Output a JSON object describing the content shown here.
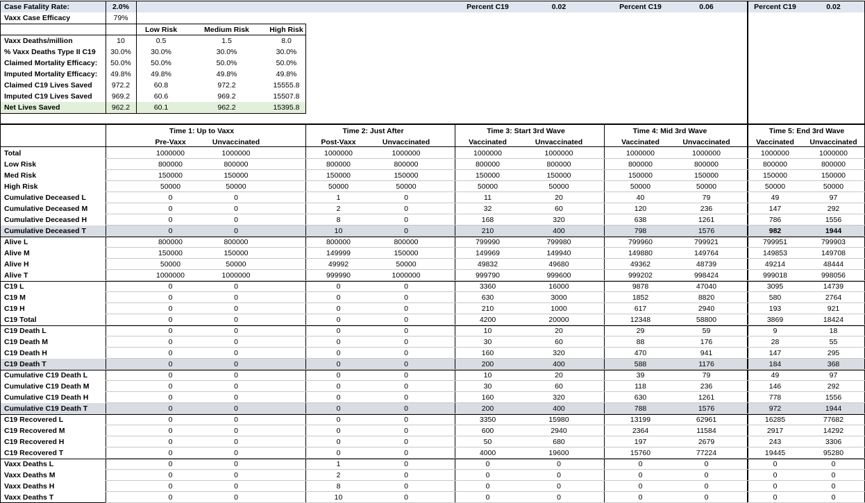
{
  "summary": {
    "case_fatality_label": "Case Fatality Rate:",
    "case_fatality_value": "2.0%",
    "vaxx_efficacy_label": "Vaxx Case Efficacy",
    "vaxx_efficacy_value": "79%",
    "percent_blocks": [
      {
        "label": "Percent C19",
        "value": "0.02"
      },
      {
        "label": "Percent C19",
        "value": "0.06"
      },
      {
        "label": "Percent C19",
        "value": "0.02"
      }
    ]
  },
  "risk_table": {
    "headers": [
      "Low Risk",
      "Medium Risk",
      "High Risk"
    ],
    "rows": [
      {
        "label": "Vaxx Deaths/million",
        "base": "10",
        "cells": [
          "0.5",
          "1.5",
          "8.0"
        ]
      },
      {
        "label": "% Vaxx Deaths Type II C19",
        "base": "30.0%",
        "cells": [
          "30.0%",
          "30.0%",
          "30.0%"
        ]
      },
      {
        "label": "Claimed Mortality Efficacy:",
        "base": "50.0%",
        "cells": [
          "50.0%",
          "50.0%",
          "50.0%"
        ]
      },
      {
        "label": "Imputed Mortality Efficacy:",
        "base": "49.8%",
        "cells": [
          "49.8%",
          "49.8%",
          "49.8%"
        ]
      },
      {
        "label": "Claimed C19 Lives Saved",
        "base": "972.2",
        "cells": [
          "60.8",
          "972.2",
          "15555.8"
        ]
      },
      {
        "label": "Imputed C19 Lives Saved",
        "base": "969.2",
        "cells": [
          "60.6",
          "969.2",
          "15507.8"
        ]
      },
      {
        "label": "Net Lives Saved",
        "base": "962.2",
        "cells": [
          "60.1",
          "962.2",
          "15395.8"
        ]
      }
    ]
  },
  "time_groups": [
    {
      "title": "Time 1: Up to Vaxx",
      "cols": [
        "Pre-Vaxx",
        "Unvaccinated"
      ]
    },
    {
      "title": "Time 2: Just After",
      "cols": [
        "Post-Vaxx",
        "Unvaccinated"
      ]
    },
    {
      "title": "Time 3: Start 3rd Wave",
      "cols": [
        "Vaccinated",
        "Unvaccinated"
      ]
    },
    {
      "title": "Time 4: Mid 3rd Wave",
      "cols": [
        "Vaccinated",
        "Unvaccinated"
      ]
    },
    {
      "title": "Time 5: End 3rd Wave",
      "cols": [
        "Vaccinated",
        "Unvaccinated"
      ]
    }
  ],
  "rows": [
    {
      "label": "Total",
      "values": [
        "1000000",
        "1000000",
        "1000000",
        "1000000",
        "1000000",
        "1000000",
        "1000000",
        "1000000",
        "1000000",
        "1000000"
      ]
    },
    {
      "label": "Low Risk",
      "values": [
        "800000",
        "800000",
        "800000",
        "800000",
        "800000",
        "800000",
        "800000",
        "800000",
        "800000",
        "800000"
      ]
    },
    {
      "label": "Med Risk",
      "values": [
        "150000",
        "150000",
        "150000",
        "150000",
        "150000",
        "150000",
        "150000",
        "150000",
        "150000",
        "150000"
      ]
    },
    {
      "label": "High Risk",
      "values": [
        "50000",
        "50000",
        "50000",
        "50000",
        "50000",
        "50000",
        "50000",
        "50000",
        "50000",
        "50000"
      ]
    },
    {
      "label": "Cumulative Deceased L",
      "values": [
        "0",
        "0",
        "1",
        "0",
        "11",
        "20",
        "40",
        "79",
        "49",
        "97"
      ]
    },
    {
      "label": "Cumulative Deceased M",
      "values": [
        "0",
        "0",
        "2",
        "0",
        "32",
        "60",
        "120",
        "236",
        "147",
        "292"
      ]
    },
    {
      "label": "Cumulative Deceased H",
      "values": [
        "0",
        "0",
        "8",
        "0",
        "168",
        "320",
        "638",
        "1261",
        "786",
        "1556"
      ]
    },
    {
      "label": "Cumulative Deceased T",
      "values": [
        "0",
        "0",
        "10",
        "0",
        "210",
        "400",
        "798",
        "1576",
        "982",
        "1944"
      ],
      "highlight": true,
      "bold_last": true
    },
    {
      "label": "Alive L",
      "values": [
        "800000",
        "800000",
        "800000",
        "800000",
        "799990",
        "799980",
        "799960",
        "799921",
        "799951",
        "799903"
      ]
    },
    {
      "label": "Alive M",
      "values": [
        "150000",
        "150000",
        "149999",
        "150000",
        "149969",
        "149940",
        "149880",
        "149764",
        "149853",
        "149708"
      ]
    },
    {
      "label": "Alive H",
      "values": [
        "50000",
        "50000",
        "49992",
        "50000",
        "49832",
        "49680",
        "49362",
        "48739",
        "49214",
        "48444"
      ]
    },
    {
      "label": "Alive T",
      "values": [
        "1000000",
        "1000000",
        "999990",
        "1000000",
        "999790",
        "999600",
        "999202",
        "998424",
        "999018",
        "998056"
      ]
    },
    {
      "label": "C19 L",
      "values": [
        "0",
        "0",
        "0",
        "0",
        "3360",
        "16000",
        "9878",
        "47040",
        "3095",
        "14739"
      ]
    },
    {
      "label": "C19 M",
      "values": [
        "0",
        "0",
        "0",
        "0",
        "630",
        "3000",
        "1852",
        "8820",
        "580",
        "2764"
      ]
    },
    {
      "label": "C19 H",
      "values": [
        "0",
        "0",
        "0",
        "0",
        "210",
        "1000",
        "617",
        "2940",
        "193",
        "921"
      ]
    },
    {
      "label": "C19 Total",
      "values": [
        "0",
        "0",
        "0",
        "0",
        "4200",
        "20000",
        "12348",
        "58800",
        "3869",
        "18424"
      ]
    },
    {
      "label": "C19 Death L",
      "values": [
        "0",
        "0",
        "0",
        "0",
        "10",
        "20",
        "29",
        "59",
        "9",
        "18"
      ]
    },
    {
      "label": "C19 Death M",
      "values": [
        "0",
        "0",
        "0",
        "0",
        "30",
        "60",
        "88",
        "176",
        "28",
        "55"
      ]
    },
    {
      "label": "C19 Death H",
      "values": [
        "0",
        "0",
        "0",
        "0",
        "160",
        "320",
        "470",
        "941",
        "147",
        "295"
      ]
    },
    {
      "label": "C19 Death T",
      "values": [
        "0",
        "0",
        "0",
        "0",
        "200",
        "400",
        "588",
        "1176",
        "184",
        "368"
      ],
      "highlight": true
    },
    {
      "label": "Cumulative C19 Death L",
      "values": [
        "0",
        "0",
        "0",
        "0",
        "10",
        "20",
        "39",
        "79",
        "49",
        "97"
      ]
    },
    {
      "label": "Cumulative C19 Death M",
      "values": [
        "0",
        "0",
        "0",
        "0",
        "30",
        "60",
        "118",
        "236",
        "146",
        "292"
      ]
    },
    {
      "label": "Cumulative C19 Death H",
      "values": [
        "0",
        "0",
        "0",
        "0",
        "160",
        "320",
        "630",
        "1261",
        "778",
        "1556"
      ]
    },
    {
      "label": "Cumulative C19 Death T",
      "values": [
        "0",
        "0",
        "0",
        "0",
        "200",
        "400",
        "788",
        "1576",
        "972",
        "1944"
      ],
      "highlight": true
    },
    {
      "label": "C19 Recovered L",
      "values": [
        "0",
        "0",
        "0",
        "0",
        "3350",
        "15980",
        "13199",
        "62961",
        "16285",
        "77682"
      ]
    },
    {
      "label": "C19 Recovered M",
      "values": [
        "0",
        "0",
        "0",
        "0",
        "600",
        "2940",
        "2364",
        "11584",
        "2917",
        "14292"
      ]
    },
    {
      "label": "C19 Recovered H",
      "values": [
        "0",
        "0",
        "0",
        "0",
        "50",
        "680",
        "197",
        "2679",
        "243",
        "3306"
      ]
    },
    {
      "label": "C19 Recovered T",
      "values": [
        "0",
        "0",
        "0",
        "0",
        "4000",
        "19600",
        "15760",
        "77224",
        "19445",
        "95280"
      ]
    },
    {
      "label": "Vaxx Deaths L",
      "values": [
        "0",
        "0",
        "1",
        "0",
        "0",
        "0",
        "0",
        "0",
        "0",
        "0"
      ]
    },
    {
      "label": "Vaxx Deaths M",
      "values": [
        "0",
        "0",
        "2",
        "0",
        "0",
        "0",
        "0",
        "0",
        "0",
        "0"
      ]
    },
    {
      "label": "Vaxx Deaths H",
      "values": [
        "0",
        "0",
        "8",
        "0",
        "0",
        "0",
        "0",
        "0",
        "0",
        "0"
      ]
    },
    {
      "label": "Vaxx Deaths T",
      "values": [
        "0",
        "0",
        "10",
        "0",
        "0",
        "0",
        "0",
        "0",
        "0",
        "0"
      ]
    }
  ]
}
